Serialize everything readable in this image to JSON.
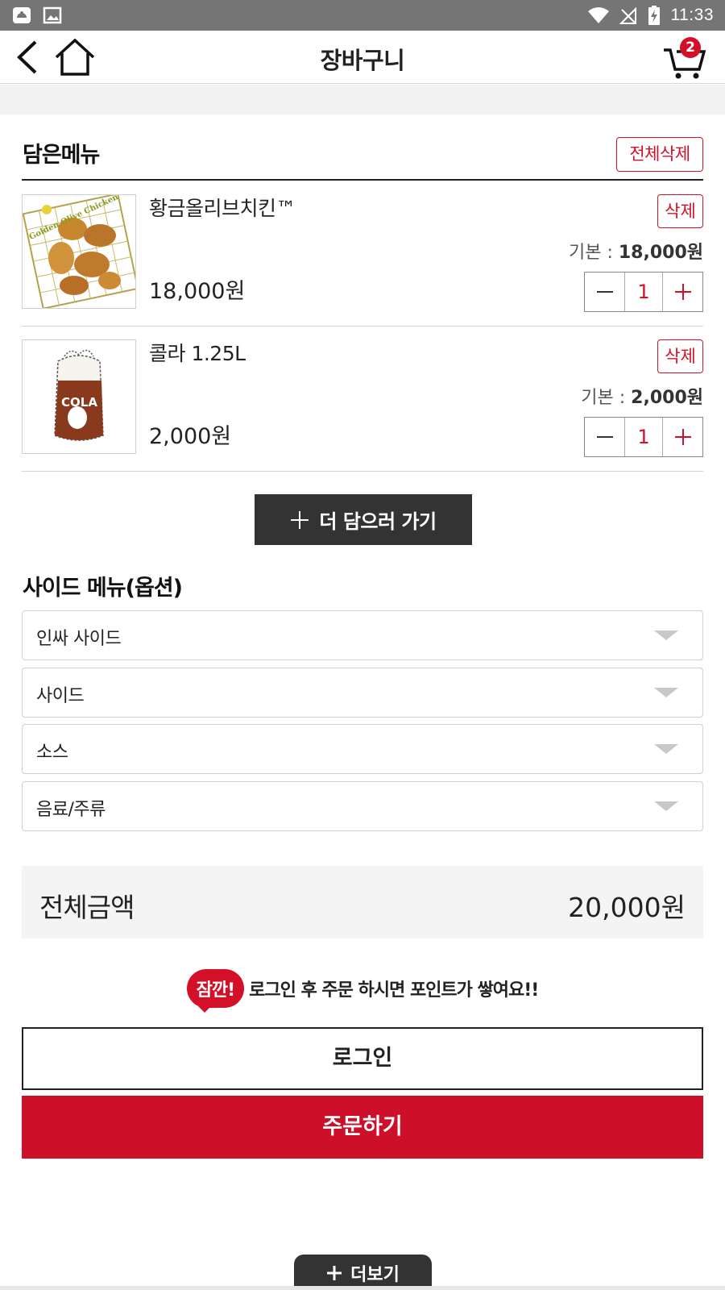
{
  "status_bar": {
    "time": "11:33"
  },
  "header": {
    "title": "장바구니",
    "cart_count": "2"
  },
  "cart": {
    "section_title": "담은메뉴",
    "clear_all_label": "전체삭제",
    "items": [
      {
        "name": "황금올리브치킨™",
        "price": "18,000원",
        "delete_label": "삭제",
        "base_label": "기본 : ",
        "base_price": "18,000원",
        "qty": "1"
      },
      {
        "name": "콜라 1.25L",
        "price": "2,000원",
        "delete_label": "삭제",
        "base_label": "기본 : ",
        "base_price": "2,000원",
        "qty": "1"
      }
    ],
    "add_more_label": "더 담으러 가기"
  },
  "side_menu": {
    "title": "사이드 메뉴(옵션)",
    "selects": [
      "인싸 사이드",
      "사이드",
      "소스",
      "음료/주류"
    ]
  },
  "total": {
    "label": "전체금액",
    "value": "20,000원"
  },
  "notice": {
    "badge": "잠깐!",
    "text": "로그인 후 주문 하시면 포인트가 쌓여요!!"
  },
  "buttons": {
    "login": "로그인",
    "order": "주문하기",
    "more": "더보기"
  },
  "colors": {
    "accent": "#d31027",
    "dark": "#333333"
  },
  "images": {
    "item_0_logo_text": "Golden Olive Chicken",
    "item_1_label_text": "COLA"
  }
}
